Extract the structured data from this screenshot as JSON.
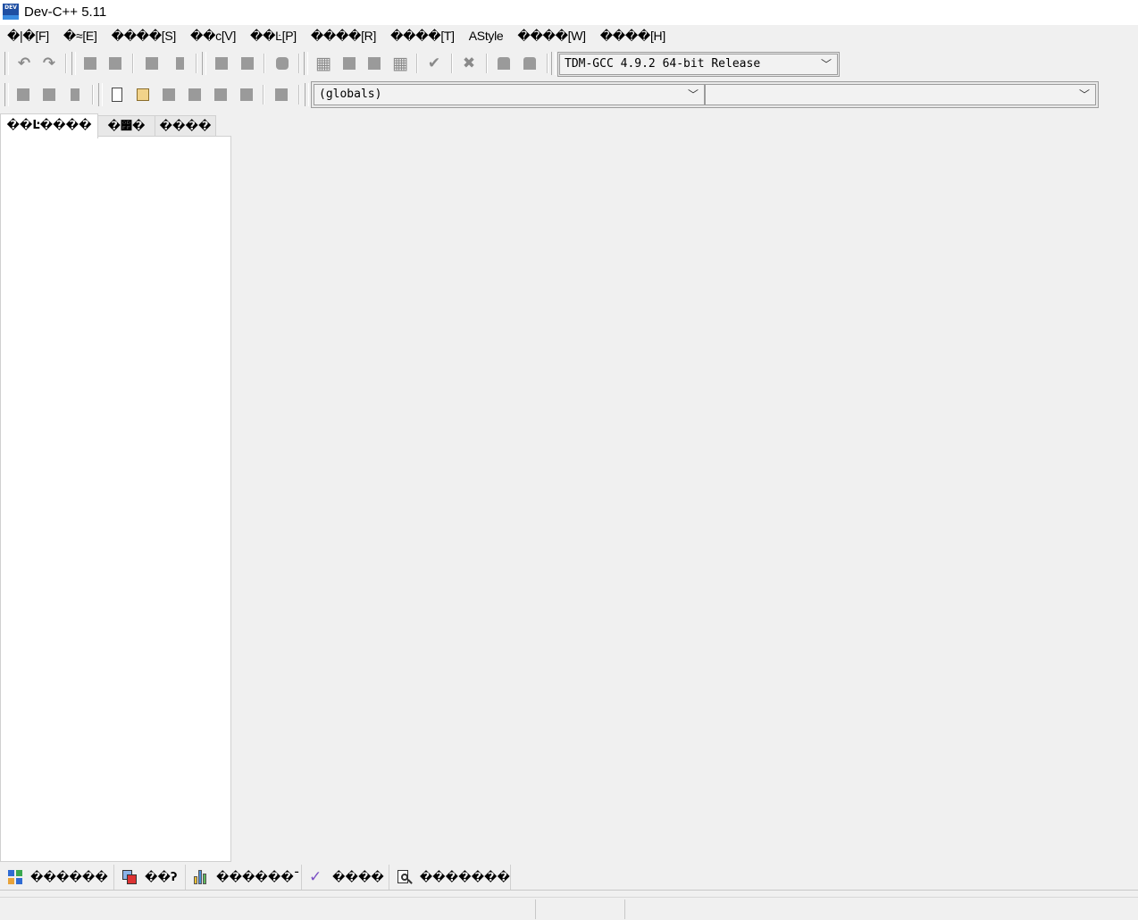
{
  "window": {
    "title": "Dev-C++ 5.11",
    "icon_label": "DEV"
  },
  "menu": [
    "�|�[F]",
    "�≈[E]",
    "����[S]",
    "��c[V]",
    "��Ŀ[P]",
    "����[R]",
    "����[T]",
    "AStyle",
    "����[W]",
    "����[H]"
  ],
  "toolbar": {
    "compiler_select": "TDM-GCC 4.9.2 64-bit Release",
    "scope_select": "(globals)",
    "member_select": ""
  },
  "left_tabs": [
    "��Ŀ����",
    "�෿�",
    "����"
  ],
  "bottom_tabs": [
    "������",
    "��ʔ",
    "������ˉ",
    "����",
    "�������"
  ],
  "status": {
    "line": "",
    "sel": "",
    "msg": ""
  }
}
